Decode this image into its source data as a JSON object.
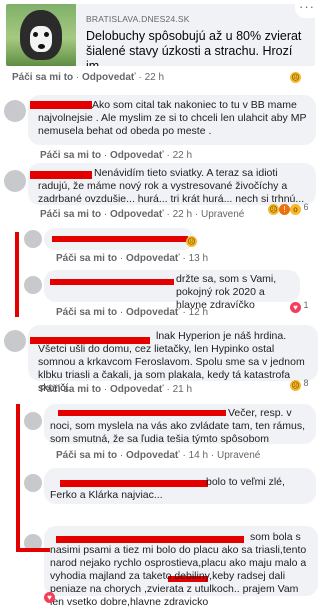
{
  "link_preview": {
    "domain": "BRATISLAVA.DNES24.SK",
    "headline": "Delobuchy spôsobujú až u 80% zvierat šialené stavy úzkosti a strachu. Hrozí im...",
    "more_label": "···"
  },
  "post_actions": {
    "like": "Páči sa mi to",
    "reply": "Odpovedať",
    "time": "22 h",
    "reaction_count": ""
  },
  "comments": [
    {
      "text": "Ako som cital tak nakoniec to tu v BB mame najvolnejsie . Ale myslim ze si to chceli len ulahcit aby MP nemusela behat od obeda po meste .",
      "like": "Páči sa mi to",
      "reply": "Odpovedať",
      "time": "22 h",
      "edited": "",
      "reaction_count": ""
    },
    {
      "text": "Nenávidím tieto sviatky. A teraz sa idioti radujú, že máme nový rok a vystresované živočíchy a zadrbané ovzdušie... hurá... tri krát hurá... nech si trhnú...",
      "like": "Páči sa mi to",
      "reply": "Odpovedať",
      "time": "22 h",
      "edited": "Upravené",
      "reaction_count": "6"
    },
    {
      "text": "",
      "like": "Páči sa mi to",
      "reply": "Odpovedať",
      "time": "13 h",
      "edited": "",
      "reaction_count": ""
    },
    {
      "text": "držte sa, som s Vami, pokojný rok 2020 a hlavne zdravíčko",
      "like": "Páči sa mi to",
      "reply": "Odpovedať",
      "time": "12 h",
      "edited": "",
      "reaction_count": "1"
    },
    {
      "text": "lnak Hyperion je náš hrdina. Všetci ušli do domu, cez lietačky, len Hypinko ostal somnou a krkavcom Feroslavom. Spolu sme sa v jednom klbku triasli a čakali, ja som plakala, kedy tá katastrofa skončí.",
      "like": "Páči sa mi to",
      "reply": "Odpovedať",
      "time": "21 h",
      "edited": "",
      "reaction_count": "8"
    },
    {
      "text": "Večer, resp. v noci, som myslela na vás ako zvládate tam, ten rámus, som smutná, že sa ľudia tešia týmto spôsobom",
      "like": "Páči sa mi to",
      "reply": "Odpovedať",
      "time": "14 h",
      "edited": "Upravené",
      "reaction_count": ""
    },
    {
      "text": "bolo to veľmi zlé, Ferko a Klárka najviac...",
      "like": "",
      "reply": "",
      "time": "",
      "edited": "",
      "reaction_count": ""
    },
    {
      "text": "som bola s nasimi psami a tiez mi bolo do placu ako sa triasli,tento narod nejako rychlo osprostieva,placu ako maju malo a vyhodia majland za taketo debiliny,keby radsej dali peniaze na chorych ,zvierata z utulkoch.. prajem Vam len vsetko dobre,hlavne zdravicko",
      "like": "",
      "reply": "",
      "time": "",
      "edited": "",
      "reaction_count": ""
    }
  ]
}
